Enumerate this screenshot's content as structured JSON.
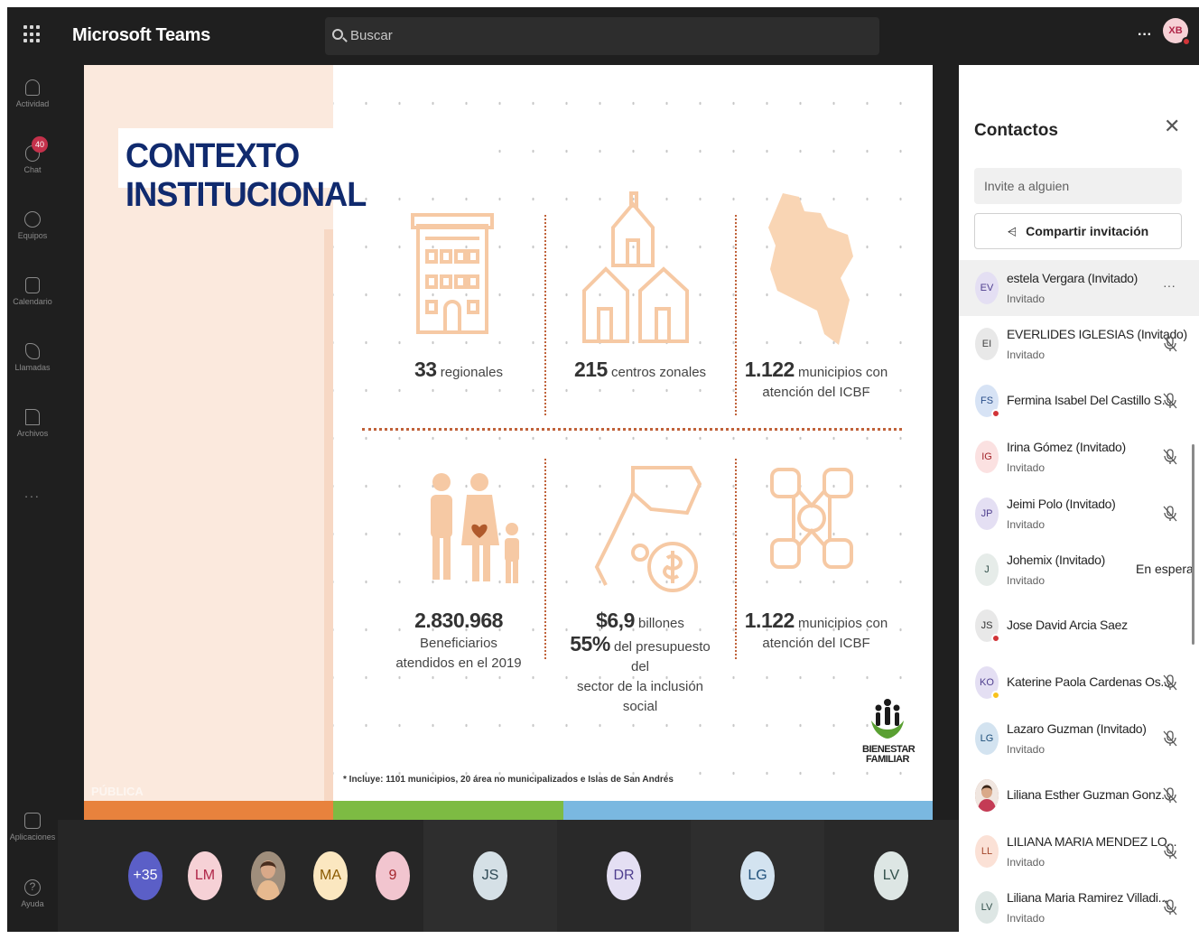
{
  "app": {
    "title": "Microsoft Teams",
    "search_placeholder": "Buscar",
    "me_initials": "XB"
  },
  "rail": [
    {
      "label": "Actividad",
      "icon": "bell-icon"
    },
    {
      "label": "Chat",
      "icon": "chat-icon",
      "badge": "40"
    },
    {
      "label": "Equipos",
      "icon": "teams-icon"
    },
    {
      "label": "Calendario",
      "icon": "calendar-icon"
    },
    {
      "label": "Llamadas",
      "icon": "phone-icon"
    },
    {
      "label": "Archivos",
      "icon": "files-icon"
    },
    {
      "label": "...",
      "icon": "more-icon"
    },
    {
      "label": "Aplicaciones",
      "icon": "apps-icon"
    },
    {
      "label": "Ayuda",
      "icon": "help-icon"
    }
  ],
  "slide": {
    "title": "CONTEXTO INSTITUCIONAL",
    "stats": [
      {
        "num": "33",
        "text": "regionales"
      },
      {
        "num": "215",
        "text": "centros zonales"
      },
      {
        "num": "1.122",
        "text": "municipios con",
        "text2": "atención del ICBF"
      },
      {
        "num": "2.830.968",
        "text": "Beneficiarios",
        "text2": "atendidos en el 2019"
      },
      {
        "num": "$6,9",
        "text": "billones",
        "num2": "55%",
        "text2": "del presupuesto del",
        "text3": "sector de la inclusión",
        "text4": "social"
      },
      {
        "num": "1.122",
        "text": "municipios con",
        "text2": "atención del ICBF"
      }
    ],
    "footnote": "* Incluye: 1101 municipios, 20 área no municipalizados e Islas de San Andrés",
    "classification": "PÚBLICA",
    "logo_line1": "BIENESTAR",
    "logo_line2": "FAMILIAR",
    "stripe_colors": [
      "#e8823d",
      "#7dbb43",
      "#7ab8e0"
    ]
  },
  "callbar": {
    "participants": [
      {
        "initials": "+35",
        "bg": "#5b5fc7",
        "fg": "#ffffff"
      },
      {
        "initials": "LM",
        "bg": "#f6d1d6",
        "fg": "#b02648"
      },
      {
        "initials": "",
        "bg": "#a07b68",
        "fg": "#ffffff",
        "photo": true
      },
      {
        "initials": "MA",
        "bg": "#fbe7c0",
        "fg": "#8a5a00"
      },
      {
        "initials": "9",
        "bg": "#f2c5cf",
        "fg": "#a4262c"
      }
    ],
    "tiles": [
      {
        "initials": "JS",
        "bg": "#d5e0e6",
        "fg": "#2f4a56"
      },
      {
        "initials": "DR",
        "bg": "#e4dff3",
        "fg": "#4f3f8f"
      },
      {
        "initials": "LG",
        "bg": "#d3e3f0",
        "fg": "#1e4f7a"
      },
      {
        "initials": "LV",
        "bg": "#dde6e4",
        "fg": "#33514c"
      }
    ]
  },
  "panel": {
    "title": "Contactos",
    "invite_placeholder": "Invite a alguien",
    "share_label": "Compartir invitación",
    "people": [
      {
        "initials": "EV",
        "name": "estela Vergara (Invitado)",
        "role": "Invitado",
        "bg": "#e4dff3",
        "fg": "#4f3f8f",
        "action": "more",
        "hover": true
      },
      {
        "initials": "EI",
        "name": "EVERLIDES IGLESIAS (Invitado)",
        "role": "Invitado",
        "bg": "#e8e8e8",
        "fg": "#444444",
        "action": "mute"
      },
      {
        "initials": "FS",
        "name": "Fermina Isabel Del Castillo S...",
        "role": "",
        "bg": "#d7e3f5",
        "fg": "#2a4f8a",
        "action": "mute",
        "presence": "#d13438"
      },
      {
        "initials": "IG",
        "name": "Irina Gómez (Invitado)",
        "role": "Invitado",
        "bg": "#fbe1e1",
        "fg": "#a4262c",
        "action": "mute"
      },
      {
        "initials": "JP",
        "name": "Jeimi Polo (Invitado)",
        "role": "Invitado",
        "bg": "#e4dff3",
        "fg": "#4f3f8f",
        "action": "mute"
      },
      {
        "initials": "J",
        "name": "Johemix (Invitado)",
        "role": "Invitado",
        "bg": "#e6ece9",
        "fg": "#33514c",
        "action": "status",
        "status": "En espera"
      },
      {
        "initials": "JS",
        "name": "Jose David Arcia Saez",
        "role": "",
        "bg": "#e8e8e8",
        "fg": "#333333",
        "action": "none",
        "presence": "#d13438"
      },
      {
        "initials": "KO",
        "name": "Katerine Paola Cardenas Os...",
        "role": "",
        "bg": "#e4dff3",
        "fg": "#4f3f8f",
        "action": "mute",
        "presence": "#f8c21c"
      },
      {
        "initials": "LG",
        "name": "Lazaro Guzman (Invitado)",
        "role": "Invitado",
        "bg": "#d3e3f0",
        "fg": "#1e4f7a",
        "action": "mute"
      },
      {
        "initials": "",
        "name": "Liliana Esther Guzman Gonz...",
        "role": "",
        "bg": "#c98d7a",
        "fg": "#ffffff",
        "action": "mute",
        "photo": true
      },
      {
        "initials": "LL",
        "name": "LILIANA MARIA MENDEZ LO...",
        "role": "Invitado",
        "bg": "#fbe1d6",
        "fg": "#a4472c",
        "action": "mute"
      },
      {
        "initials": "LV",
        "name": "Liliana Maria Ramirez Villadi...",
        "role": "Invitado",
        "bg": "#dde6e4",
        "fg": "#33514c",
        "action": "mute"
      }
    ]
  }
}
